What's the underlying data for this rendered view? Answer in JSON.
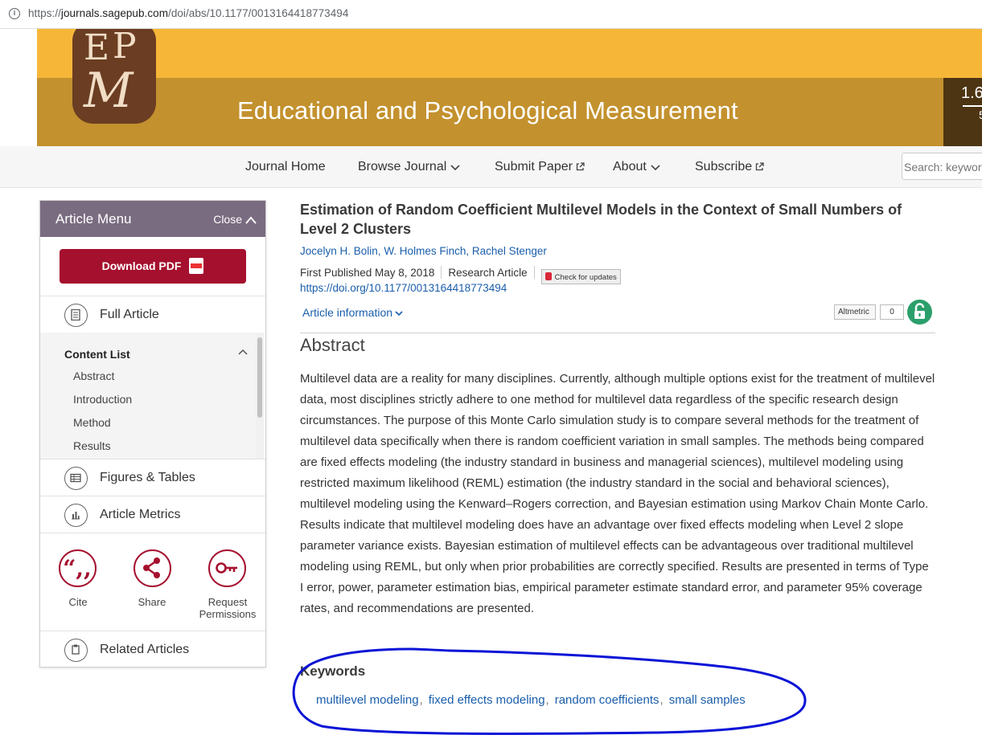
{
  "browser": {
    "url_prefix": "https://",
    "url_host": "journals.sagepub.com",
    "url_path": "/doi/abs/10.1177/0013164418773494"
  },
  "banner": {
    "journal_title": "Educational and Psychological Measurement",
    "side_value": "1.6",
    "side_small": "5",
    "logo_letters": [
      "E",
      "P",
      "M"
    ]
  },
  "nav": {
    "journal_home": "Journal Home",
    "browse_journal": "Browse Journal",
    "submit_paper": "Submit Paper",
    "about": "About",
    "subscribe": "Subscribe",
    "search_placeholder": "Search: keywords"
  },
  "article_menu": {
    "title": "Article Menu",
    "close_label": "Close",
    "download_pdf": "Download PDF",
    "full_article": "Full Article",
    "content_list": {
      "heading": "Content List",
      "items": [
        "Abstract",
        "Introduction",
        "Method",
        "Results"
      ]
    },
    "figures_tables": "Figures & Tables",
    "article_metrics": "Article Metrics",
    "actions": {
      "cite": "Cite",
      "share": "Share",
      "request_line1": "Request",
      "request_line2": "Permissions"
    },
    "related_articles": "Related Articles"
  },
  "article": {
    "title": "Estimation of Random Coefficient Multilevel Models in the Context of Small Numbers of Level 2 Clusters",
    "authors": [
      "Jocelyn H. Bolin",
      "W. Holmes Finch",
      "Rachel Stenger"
    ],
    "first_published": "First Published May 8, 2018",
    "article_type": "Research Article",
    "check_updates": "Check for updates",
    "doi": "https://doi.org/10.1177/0013164418773494",
    "article_information": "Article information",
    "altmetric_label": "Altmetric",
    "altmetric_score": "0",
    "abstract_heading": "Abstract",
    "abstract_text": "Multilevel data are a reality for many disciplines. Currently, although multiple options exist for the treatment of multilevel data, most disciplines strictly adhere to one method for multilevel data regardless of the specific research design circumstances. The purpose of this Monte Carlo simulation study is to compare several methods for the treatment of multilevel data specifically when there is random coefficient variation in small samples. The methods being compared are fixed effects modeling (the industry standard in business and managerial sciences), multilevel modeling using restricted maximum likelihood (REML) estimation (the industry standard in the social and behavioral sciences), multilevel modeling using the Kenward–Rogers correction, and Bayesian estimation using Markov Chain Monte Carlo. Results indicate that multilevel modeling does have an advantage over fixed effects modeling when Level 2 slope parameter variance exists. Bayesian estimation of multilevel effects can be advantageous over traditional multilevel modeling using REML, but only when prior probabilities are correctly specified. Results are presented in terms of Type I error, power, parameter estimation bias, empirical parameter estimate standard error, and parameter 95% coverage rates, and recommendations are presented.",
    "keywords_heading": "Keywords",
    "keywords": [
      "multilevel modeling",
      "fixed effects modeling",
      "random coefficients",
      "small samples"
    ]
  },
  "colors": {
    "banner_top": "#f6b739",
    "banner_bottom": "#c3912e",
    "menu_header": "#7a6c80",
    "pdf_button": "#a5102e",
    "link": "#1a5eab",
    "annotation": "#0a14d6",
    "open_access": "#2b9f6b"
  }
}
